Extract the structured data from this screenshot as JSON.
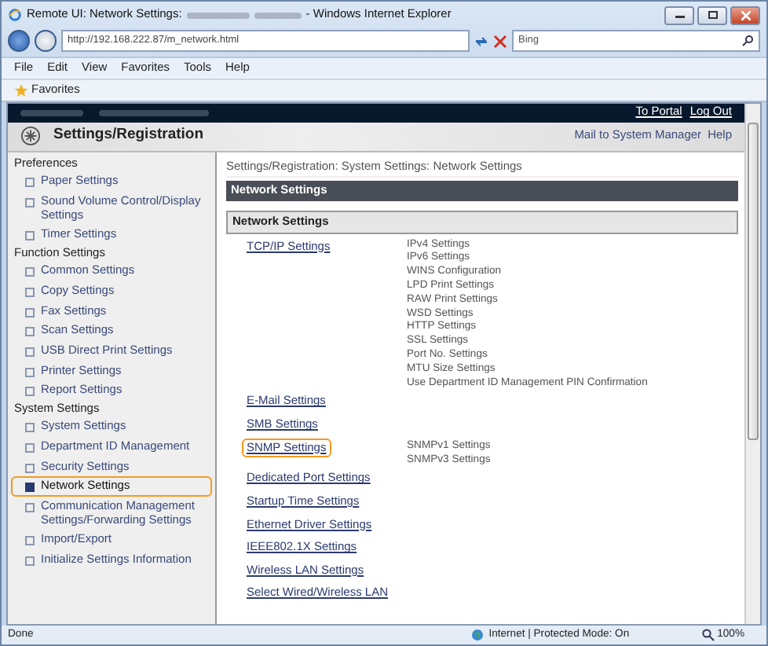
{
  "window": {
    "title_start": "Remote UI: Network Settings:",
    "title_end": "- Windows Internet Explorer"
  },
  "address_bar": {
    "url": "http://192.168.222.87/m_network.html"
  },
  "search": {
    "placeholder": "Bing"
  },
  "menu": [
    "File",
    "Edit",
    "View",
    "Favorites",
    "Tools",
    "Help"
  ],
  "favorites": "Favorites",
  "top_links": [
    "To Portal",
    "Log Out"
  ],
  "header": {
    "title": "Settings/Registration",
    "links": [
      "Mail to System Manager",
      "Help"
    ]
  },
  "sidebar": {
    "groups": [
      {
        "label": "Preferences",
        "items": [
          {
            "label": "Paper Settings",
            "selected": false
          },
          {
            "label": "Sound Volume Control/Display Settings",
            "selected": false
          },
          {
            "label": "Timer Settings",
            "selected": false
          }
        ]
      },
      {
        "label": "Function Settings",
        "items": [
          {
            "label": "Common Settings",
            "selected": false
          },
          {
            "label": "Copy Settings",
            "selected": false
          },
          {
            "label": "Fax Settings",
            "selected": false
          },
          {
            "label": "Scan Settings",
            "selected": false
          },
          {
            "label": "USB Direct Print Settings",
            "selected": false
          },
          {
            "label": "Printer Settings",
            "selected": false
          },
          {
            "label": "Report Settings",
            "selected": false
          }
        ]
      },
      {
        "label": "System Settings",
        "items": [
          {
            "label": "System Settings",
            "selected": false
          },
          {
            "label": "Department ID Management",
            "selected": false
          },
          {
            "label": "Security Settings",
            "selected": false
          },
          {
            "label": "Network Settings",
            "selected": true
          },
          {
            "label": "Communication Management Settings/Forwarding Settings",
            "selected": false
          },
          {
            "label": "Import/Export",
            "selected": false
          },
          {
            "label": "Initialize Settings Information",
            "selected": false
          }
        ]
      }
    ]
  },
  "breadcrumb": "Settings/Registration: System Settings: Network Settings",
  "page_title": "Network Settings",
  "section_title": "Network Settings",
  "links": [
    {
      "label": "TCP/IP Settings",
      "highlighted": false,
      "details": [
        "IPv4 Settings",
        "IPv6 Settings",
        "WINS Configuration",
        "LPD Print Settings",
        "RAW Print Settings",
        "WSD Settings",
        "HTTP Settings",
        "SSL Settings",
        "Port No. Settings",
        "MTU Size Settings",
        "Use Department ID Management PIN Confirmation"
      ]
    },
    {
      "label": "E-Mail Settings",
      "highlighted": false
    },
    {
      "label": "SMB Settings",
      "highlighted": false
    },
    {
      "label": "SNMP Settings",
      "highlighted": true,
      "details": [
        "SNMPv1 Settings",
        "SNMPv3 Settings"
      ]
    },
    {
      "label": "Dedicated Port Settings",
      "highlighted": false
    },
    {
      "label": "Startup Time Settings",
      "highlighted": false
    },
    {
      "label": "Ethernet Driver Settings",
      "highlighted": false
    },
    {
      "label": "IEEE802.1X Settings",
      "highlighted": false
    },
    {
      "label": "Wireless LAN Settings",
      "highlighted": false
    },
    {
      "label": "Select Wired/Wireless LAN",
      "highlighted": false
    }
  ],
  "status_bar": {
    "status": "Done",
    "zone": "Internet | Protected Mode: On",
    "zoom": "100%"
  }
}
